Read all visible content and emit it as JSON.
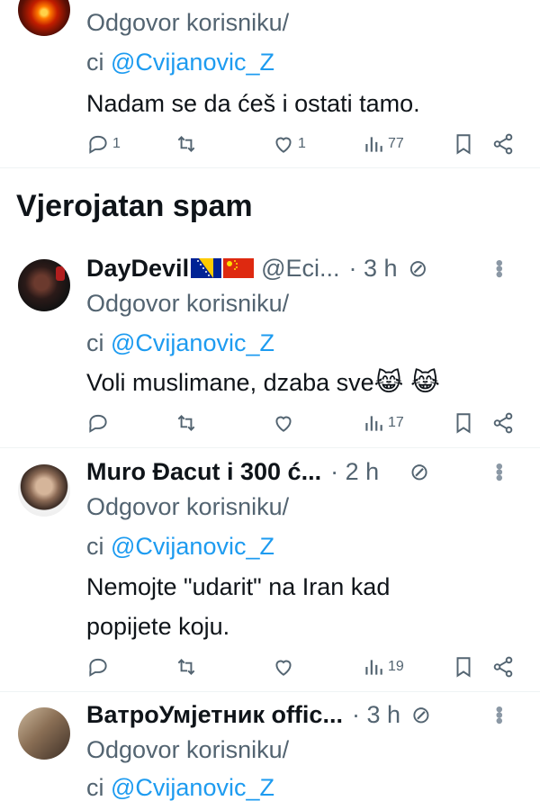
{
  "top_tweet": {
    "reply_to": "Odgovor korisniku/",
    "reply_to_prefix": "ci",
    "mention": "@Cvijanovic_Z",
    "text": "Nadam se da ćeš i ostati tamo.",
    "replies": "1",
    "likes": "1",
    "views": "77"
  },
  "section_title": "Vjerojatan spam",
  "tweets": [
    {
      "name": "DayDevil",
      "handle": "@Eci...",
      "time": "· 3 h",
      "reply_to": "Odgovor korisniku/",
      "reply_to_prefix": "ci",
      "mention": "@Cvijanovic_Z",
      "text_lines": [
        "Voli muslimane, dzaba sve"
      ],
      "emoji": "😹 😹",
      "views": "17"
    },
    {
      "name": "Muro Đacut i 300 ć...",
      "handle": "",
      "time": "· 2 h",
      "reply_to": "Odgovor korisniku/",
      "reply_to_prefix": "ci",
      "mention": "@Cvijanovic_Z",
      "text_lines": [
        "Nemojte \"udarit\" na Iran kad",
        "popijete koju."
      ],
      "views": "19"
    },
    {
      "name": "ВатроУмјетник offic...",
      "handle": "",
      "time": "· 3 h",
      "reply_to": "Odgovor korisniku/",
      "reply_to_prefix": "ci",
      "mention": "@Cvijanovic_Z"
    }
  ],
  "colors": {
    "text": "#0f1419",
    "secondary": "#536471",
    "link": "#1d9bf0",
    "divider": "#eff3f4"
  },
  "icons": [
    "reply-icon",
    "retweet-icon",
    "like-icon",
    "views-icon",
    "bookmark-icon",
    "share-icon",
    "mute-icon",
    "more-icon"
  ]
}
